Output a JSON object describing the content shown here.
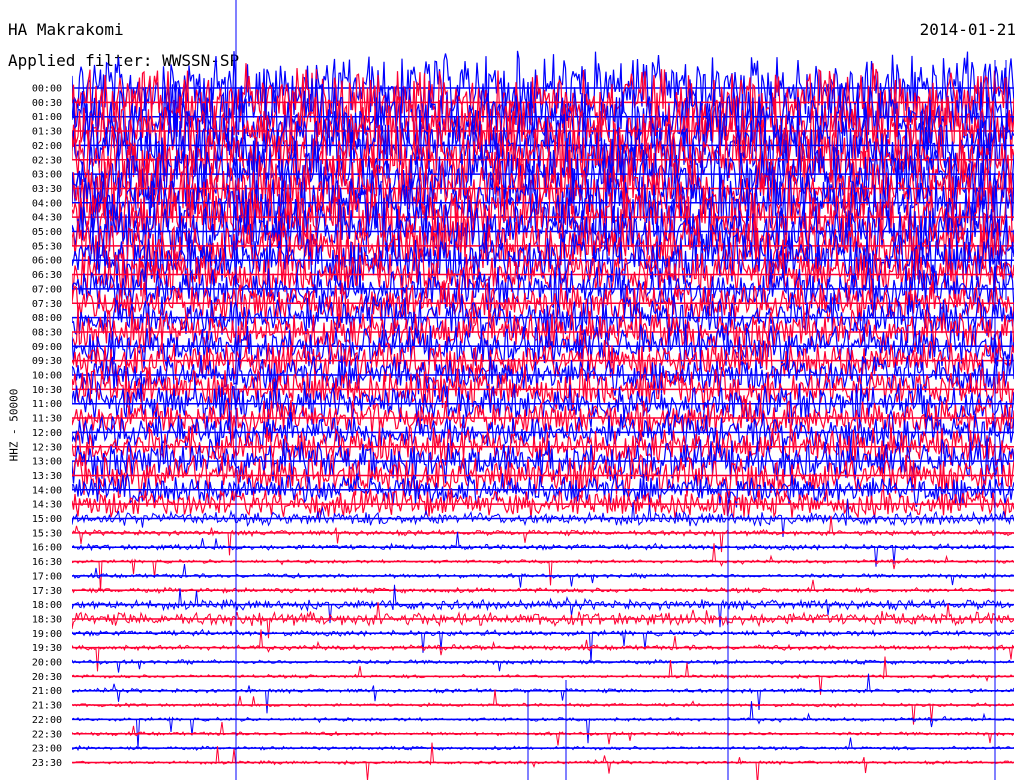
{
  "header": {
    "station": "HA Makrakomi",
    "date": "2014-01-21",
    "filter": "Applied filter: WWSSN-SP"
  },
  "chart_data": {
    "type": "line",
    "title": "HA Makrakomi",
    "ylabel": "HHZ - 50000",
    "row_interval": "30 min",
    "colors": [
      "#0000ff",
      "#ff0033"
    ],
    "rows": [
      {
        "time": "00:00",
        "color": "#0000ff",
        "amplitude": 1.0
      },
      {
        "time": "00:30",
        "color": "#ff0033",
        "amplitude": 1.0
      },
      {
        "time": "01:00",
        "color": "#0000ff",
        "amplitude": 1.0
      },
      {
        "time": "01:30",
        "color": "#ff0033",
        "amplitude": 1.0
      },
      {
        "time": "02:00",
        "color": "#0000ff",
        "amplitude": 1.0
      },
      {
        "time": "02:30",
        "color": "#ff0033",
        "amplitude": 1.0
      },
      {
        "time": "03:00",
        "color": "#0000ff",
        "amplitude": 1.0
      },
      {
        "time": "03:30",
        "color": "#ff0033",
        "amplitude": 1.0
      },
      {
        "time": "04:00",
        "color": "#0000ff",
        "amplitude": 0.95
      },
      {
        "time": "04:30",
        "color": "#ff0033",
        "amplitude": 0.95
      },
      {
        "time": "05:00",
        "color": "#0000ff",
        "amplitude": 0.9
      },
      {
        "time": "05:30",
        "color": "#ff0033",
        "amplitude": 0.85
      },
      {
        "time": "06:00",
        "color": "#0000ff",
        "amplitude": 0.8
      },
      {
        "time": "06:30",
        "color": "#ff0033",
        "amplitude": 0.7
      },
      {
        "time": "07:00",
        "color": "#0000ff",
        "amplitude": 0.65
      },
      {
        "time": "07:30",
        "color": "#ff0033",
        "amplitude": 0.6
      },
      {
        "time": "08:00",
        "color": "#0000ff",
        "amplitude": 0.65
      },
      {
        "time": "08:30",
        "color": "#ff0033",
        "amplitude": 0.6
      },
      {
        "time": "09:00",
        "color": "#0000ff",
        "amplitude": 0.6
      },
      {
        "time": "09:30",
        "color": "#ff0033",
        "amplitude": 0.6
      },
      {
        "time": "10:00",
        "color": "#0000ff",
        "amplitude": 0.55
      },
      {
        "time": "10:30",
        "color": "#ff0033",
        "amplitude": 0.6
      },
      {
        "time": "11:00",
        "color": "#0000ff",
        "amplitude": 0.6
      },
      {
        "time": "11:30",
        "color": "#ff0033",
        "amplitude": 0.5
      },
      {
        "time": "12:00",
        "color": "#0000ff",
        "amplitude": 0.55
      },
      {
        "time": "12:30",
        "color": "#ff0033",
        "amplitude": 0.55
      },
      {
        "time": "13:00",
        "color": "#0000ff",
        "amplitude": 0.6
      },
      {
        "time": "13:30",
        "color": "#ff0033",
        "amplitude": 0.6
      },
      {
        "time": "14:00",
        "color": "#0000ff",
        "amplitude": 0.45
      },
      {
        "time": "14:30",
        "color": "#ff0033",
        "amplitude": 0.4
      },
      {
        "time": "15:00",
        "color": "#0000ff",
        "amplitude": 0.2
      },
      {
        "time": "15:30",
        "color": "#ff0033",
        "amplitude": 0.08
      },
      {
        "time": "16:00",
        "color": "#0000ff",
        "amplitude": 0.08
      },
      {
        "time": "16:30",
        "color": "#ff0033",
        "amplitude": 0.05
      },
      {
        "time": "17:00",
        "color": "#0000ff",
        "amplitude": 0.06
      },
      {
        "time": "17:30",
        "color": "#ff0033",
        "amplitude": 0.07
      },
      {
        "time": "18:00",
        "color": "#0000ff",
        "amplitude": 0.15
      },
      {
        "time": "18:30",
        "color": "#ff0033",
        "amplitude": 0.2
      },
      {
        "time": "19:00",
        "color": "#0000ff",
        "amplitude": 0.08
      },
      {
        "time": "19:30",
        "color": "#ff0033",
        "amplitude": 0.07
      },
      {
        "time": "20:00",
        "color": "#0000ff",
        "amplitude": 0.06
      },
      {
        "time": "20:30",
        "color": "#ff0033",
        "amplitude": 0.05
      },
      {
        "time": "21:00",
        "color": "#0000ff",
        "amplitude": 0.06
      },
      {
        "time": "21:30",
        "color": "#ff0033",
        "amplitude": 0.05
      },
      {
        "time": "22:00",
        "color": "#0000ff",
        "amplitude": 0.05
      },
      {
        "time": "22:30",
        "color": "#ff0033",
        "amplitude": 0.05
      },
      {
        "time": "23:00",
        "color": "#0000ff",
        "amplitude": 0.05
      },
      {
        "time": "23:30",
        "color": "#ff0033",
        "amplitude": 0.05
      }
    ]
  }
}
